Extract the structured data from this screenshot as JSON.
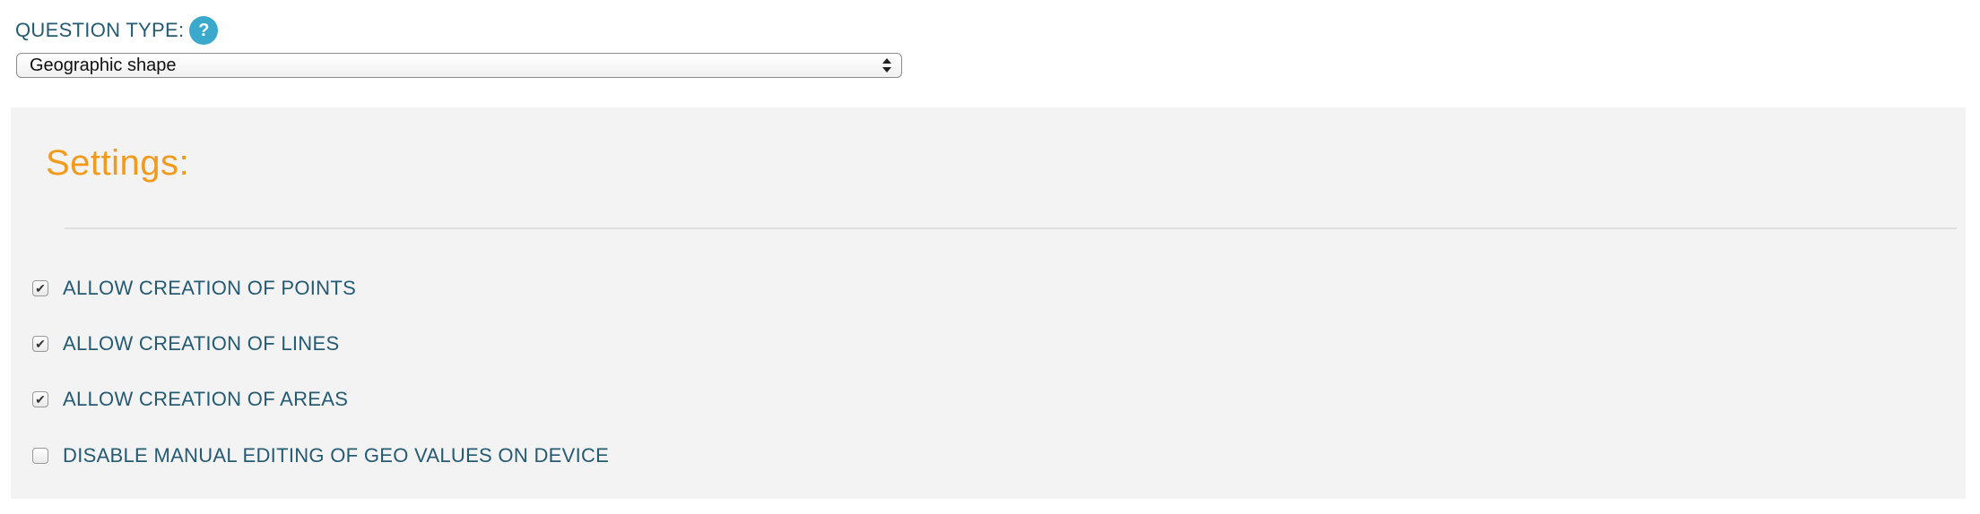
{
  "question_type": {
    "label": "QUESTION TYPE:",
    "help_glyph": "?",
    "help_icon": "question-circle-icon",
    "help_color": "#3aa9cc",
    "selected": "Geographic shape"
  },
  "settings": {
    "title": "Settings:",
    "title_color": "#f29a1b",
    "options": [
      {
        "label": "ALLOW CREATION OF POINTS",
        "checked": true
      },
      {
        "label": "ALLOW CREATION OF LINES",
        "checked": true
      },
      {
        "label": "ALLOW CREATION OF AREAS",
        "checked": true
      },
      {
        "label": "DISABLE MANUAL EDITING OF GEO VALUES ON DEVICE",
        "checked": false
      }
    ]
  }
}
